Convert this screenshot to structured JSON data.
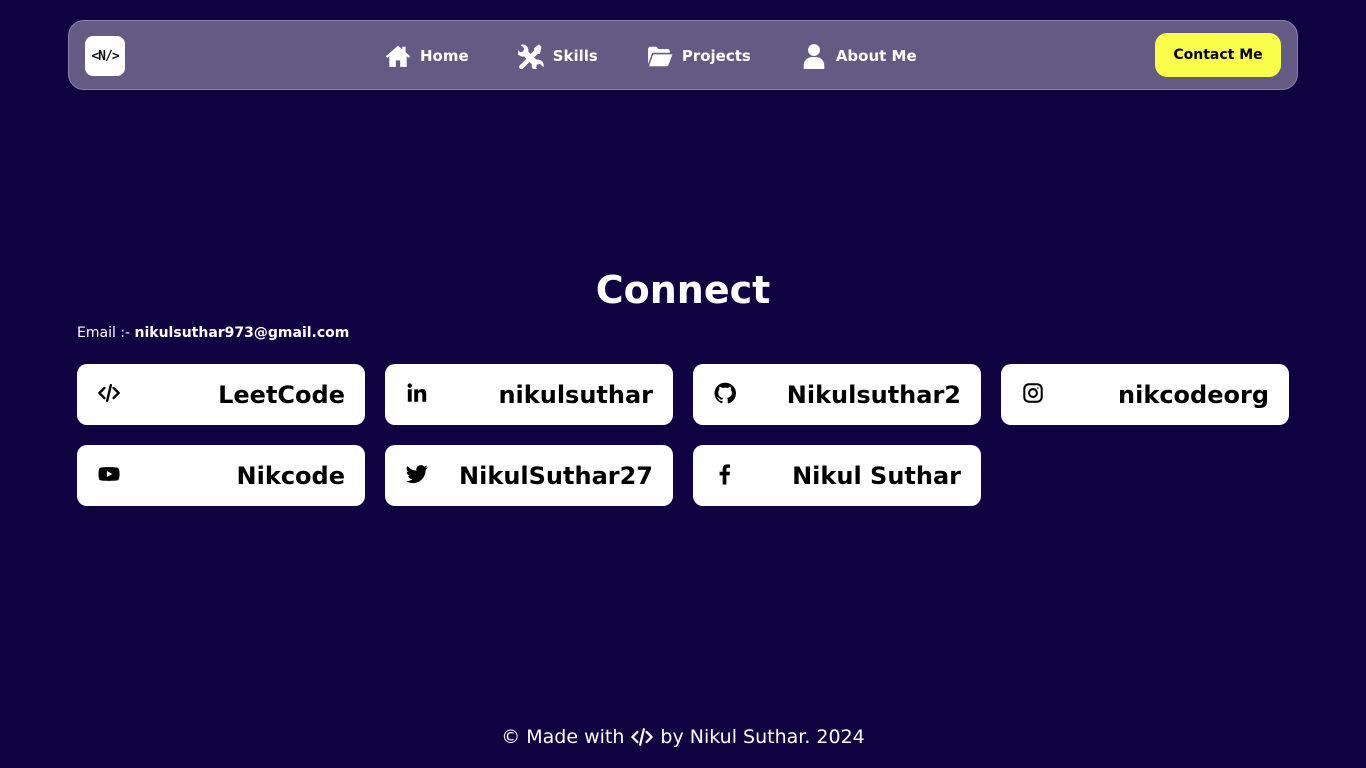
{
  "nav": {
    "logo_text": "<N/>",
    "links": [
      {
        "label": "Home",
        "icon": "home-icon"
      },
      {
        "label": "Skills",
        "icon": "tools-icon"
      },
      {
        "label": "Projects",
        "icon": "folder-open-icon"
      },
      {
        "label": "About Me",
        "icon": "user-icon"
      }
    ],
    "contact_label": "Contact Me"
  },
  "connect": {
    "title": "Connect",
    "email_label": "Email :-",
    "email_value": "nikulsuthar973@gmail.com",
    "links": [
      {
        "label": "LeetCode",
        "icon": "code-icon"
      },
      {
        "label": "nikulsuthar",
        "icon": "linkedin-icon"
      },
      {
        "label": "Nikulsuthar2",
        "icon": "github-icon"
      },
      {
        "label": "nikcodeorg",
        "icon": "instagram-icon"
      },
      {
        "label": "Nikcode",
        "icon": "youtube-icon"
      },
      {
        "label": "NikulSuthar27",
        "icon": "twitter-icon"
      },
      {
        "label": "Nikul Suthar",
        "icon": "facebook-icon"
      }
    ]
  },
  "footer": {
    "prefix": "© Made with",
    "suffix": "by Nikul Suthar. 2024",
    "icon": "code-icon"
  },
  "colors": {
    "background": "#100342",
    "navbar": "#645b84",
    "accent": "#fafd4a",
    "card": "#ffffff"
  }
}
